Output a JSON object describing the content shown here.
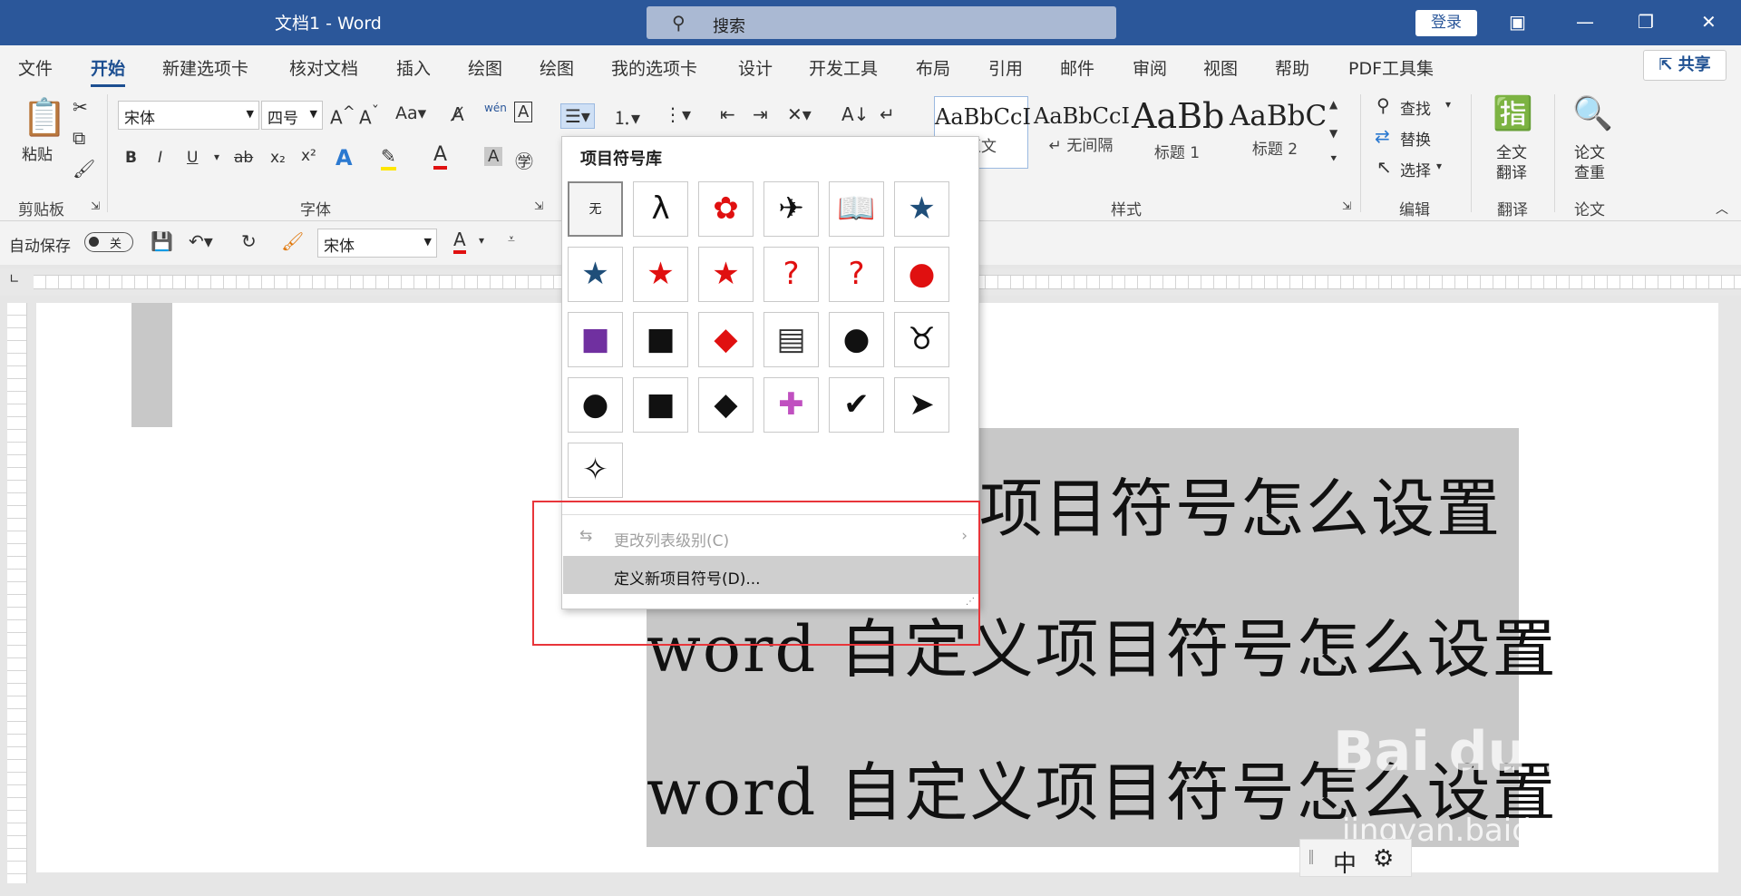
{
  "titlebar": {
    "title": "文档1  -  Word",
    "search_placeholder": "搜索",
    "login": "登录"
  },
  "tabs": [
    "文件",
    "开始",
    "新建选项卡",
    "核对文档",
    "插入",
    "绘图",
    "绘图",
    "我的选项卡",
    "设计",
    "开发工具",
    "布局",
    "引用",
    "邮件",
    "审阅",
    "视图",
    "帮助",
    "PDF工具集"
  ],
  "active_tab": "开始",
  "share": "共享",
  "ribbon": {
    "clipboard": {
      "paste": "粘贴",
      "label": "剪贴板"
    },
    "font": {
      "name": "宋体",
      "size": "四号",
      "case": "Aa",
      "phonetic": "wén",
      "label": "字体"
    },
    "styles": {
      "items": [
        {
          "preview": "AaBbCcI",
          "name": "正文"
        },
        {
          "preview": "AaBbCcI",
          "name": "↵ 无间隔"
        },
        {
          "preview": "AaBb",
          "name": "标题 1"
        },
        {
          "preview": "AaBbC",
          "name": "标题 2"
        }
      ],
      "label": "样式"
    },
    "editing": {
      "find": "查找",
      "replace": "替换",
      "select": "选择",
      "label": "编辑"
    },
    "translate": {
      "full": "全文",
      "full2": "翻译",
      "label": "翻译"
    },
    "paper": {
      "check": "论文",
      "check2": "查重",
      "label": "论文"
    }
  },
  "qat": {
    "autosave": "自动保存",
    "toggle": "关",
    "font": "宋体"
  },
  "bullet_library": {
    "title": "项目符号库",
    "none_label": "无",
    "change_level": "更改列表级别(C)",
    "define_new": "定义新项目符号(D)...",
    "symbols": [
      {
        "glyph": "λ",
        "color": "#111111",
        "icon": "lambda-icon"
      },
      {
        "glyph": "✿",
        "color": "#e01010",
        "icon": "flower-icon"
      },
      {
        "glyph": "✈",
        "color": "#111111",
        "icon": "airplane-icon"
      },
      {
        "glyph": "📖",
        "color": "#2b579a",
        "icon": "book-icon"
      },
      {
        "glyph": "★",
        "color": "#1f4e79",
        "icon": "star-icon"
      },
      {
        "glyph": "★",
        "color": "#1f4e79",
        "icon": "star-icon"
      },
      {
        "glyph": "★",
        "color": "#e01010",
        "icon": "star-icon"
      },
      {
        "glyph": "★",
        "color": "#e01010",
        "icon": "star-icon"
      },
      {
        "glyph": "?",
        "color": "#e01010",
        "icon": "question-icon"
      },
      {
        "glyph": "?",
        "color": "#e01010",
        "icon": "question-icon"
      },
      {
        "glyph": "●",
        "color": "#e01010",
        "icon": "circle-icon"
      },
      {
        "glyph": "■",
        "color": "#7030a0",
        "icon": "square-icon"
      },
      {
        "glyph": "■",
        "color": "#111111",
        "icon": "square-icon"
      },
      {
        "glyph": "◆",
        "color": "#e01010",
        "icon": "diamond-icon"
      },
      {
        "glyph": "▤",
        "color": "#333333",
        "icon": "document-icon"
      },
      {
        "glyph": "●",
        "color": "#111111",
        "icon": "circle-icon"
      },
      {
        "glyph": "♉",
        "color": "#111111",
        "icon": "taurus-icon"
      },
      {
        "glyph": "●",
        "color": "#111111",
        "icon": "circle-icon"
      },
      {
        "glyph": "■",
        "color": "#111111",
        "icon": "square-icon"
      },
      {
        "glyph": "◆",
        "color": "#111111",
        "icon": "diamond-icon"
      },
      {
        "glyph": "✚",
        "color": "#c050c0",
        "icon": "color-plus-icon"
      },
      {
        "glyph": "✔",
        "color": "#111111",
        "icon": "checkmark-icon"
      },
      {
        "glyph": "➤",
        "color": "#111111",
        "icon": "arrowhead-icon"
      },
      {
        "glyph": "✧",
        "color": "#111111",
        "icon": "four-point-star-icon"
      }
    ]
  },
  "document": {
    "lines": [
      "项目符号怎么设置",
      "word 自定义项目符号怎么设置",
      "word 自定义项目符号怎么设置"
    ]
  },
  "ime": {
    "mode": "中"
  },
  "watermark": {
    "brand": "Bai du 经验",
    "url": "jingyan.baidu.com"
  }
}
